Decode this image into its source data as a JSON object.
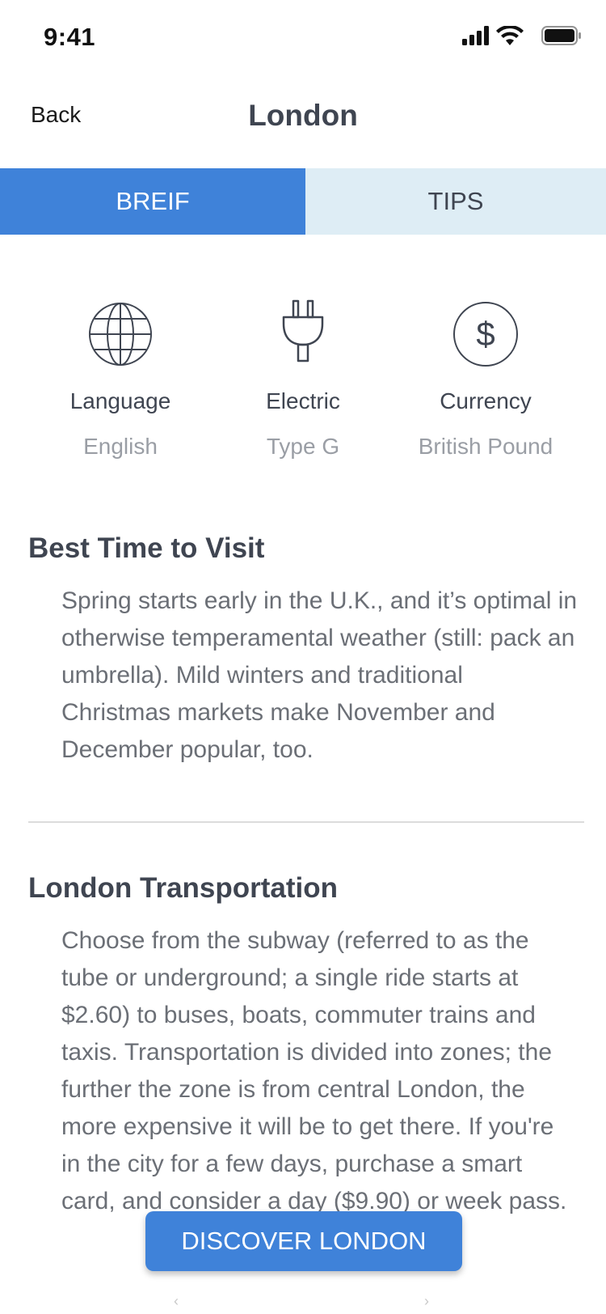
{
  "status_bar": {
    "time": "9:41"
  },
  "nav": {
    "back_label": "Back",
    "title": "London"
  },
  "tabs": [
    {
      "label": "BREIF",
      "active": true
    },
    {
      "label": "TIPS",
      "active": false
    }
  ],
  "info": [
    {
      "icon": "globe-icon",
      "label": "Language",
      "value": "English"
    },
    {
      "icon": "plug-icon",
      "label": "Electric",
      "value": "Type G"
    },
    {
      "icon": "dollar-icon",
      "label": "Currency",
      "value": "British Pound"
    }
  ],
  "sections": [
    {
      "title": "Best Time to Visit",
      "body": "Spring starts early in the U.K., and it’s optimal in otherwise temperamental weather (still: pack an umbrella). Mild winters and traditional Christmas markets make November and December popular, too."
    },
    {
      "title": "London Transportation",
      "body": "Choose from the subway (referred to as the tube or underground; a single ride starts at $2.60) to buses, boats, commuter trains and taxis. Transportation is divided into zones; the further the zone is from central London, the more expensive it will be to get there. If you're in the city for a few days, purchase a smart card, and consider a day ($9.90) or week pass."
    }
  ],
  "cta": {
    "label": "DISCOVER LONDON"
  },
  "colors": {
    "accent": "#3f82d9",
    "tab_inactive_bg": "#deedf5",
    "heading": "#3f4551",
    "muted": "#9a9ea5"
  }
}
